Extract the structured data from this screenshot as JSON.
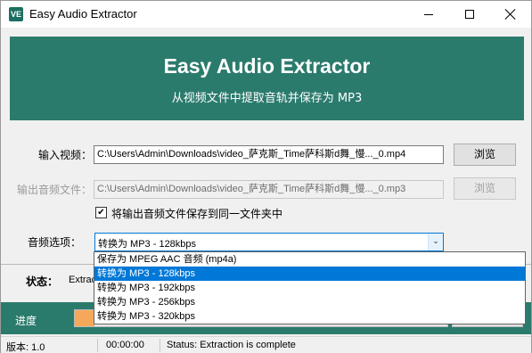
{
  "window": {
    "title": "Easy Audio Extractor",
    "icon_text": "VE"
  },
  "banner": {
    "title": "Easy Audio Extractor",
    "subtitle": "从视频文件中提取音轨并保存为 MP3",
    "color": "#2b7b6d"
  },
  "form": {
    "input_label": "输入视频：",
    "input_value": "C:\\Users\\Admin\\Downloads\\video_萨克斯_Time萨科斯d舞_慢..._0.mp4",
    "input_browse": "浏览",
    "output_label": "输出音频文件：",
    "output_value": "C:\\Users\\Admin\\Downloads\\video_萨克斯_Time萨科斯d舞_慢..._0.mp3",
    "output_browse": "浏览",
    "same_folder_checked": true,
    "same_folder_check": "✔",
    "same_folder_label": "将输出音频文件保存到同一文件夹中",
    "audio_option_label": "音频选项：",
    "audio_option_selected": "转换为 MP3 - 128kbps",
    "audio_options": [
      "保存为 MPEG AAC 音频 (mp4a)",
      "转换为 MP3 - 128kbps",
      "转换为 MP3 - 192kbps",
      "转换为 MP3 - 256kbps",
      "转换为 MP3 - 320kbps"
    ]
  },
  "status": {
    "label": "状态：",
    "text": "Extrac"
  },
  "progress": {
    "label": "进度",
    "fill_color": "#f6a85a"
  },
  "statusbar": {
    "version": "版本: 1.0",
    "time": "00:00:00",
    "status": "Status: Extraction is complete"
  }
}
